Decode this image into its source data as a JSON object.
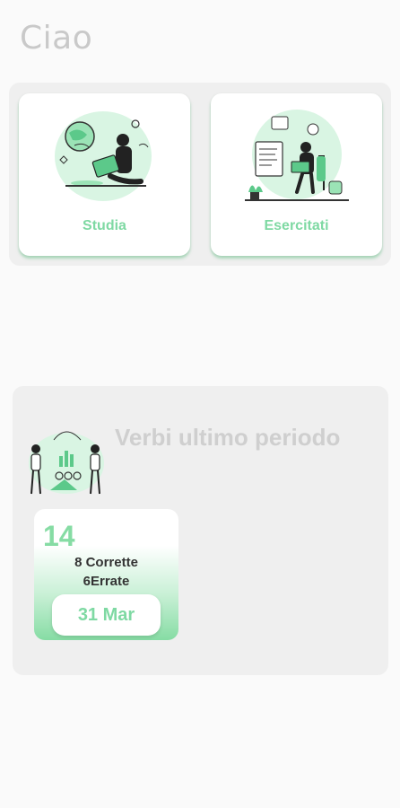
{
  "greeting": "Ciao",
  "actions": {
    "study_label": "Studia",
    "practice_label": "Esercitati"
  },
  "stats": {
    "title": "Verbi ultimo periodo",
    "days": [
      {
        "count": "14",
        "correct": "8 Corrette",
        "wrong": "6Errate",
        "date": "31 Mar"
      }
    ]
  },
  "icons": {
    "study": "person-reading-globe-illustration",
    "practice": "person-laptop-illustration",
    "stats": "people-charts-illustration"
  },
  "colors": {
    "accent": "#7fd9a3",
    "accent_light": "#d9f5e3",
    "background": "#fafafa",
    "panel": "#efefef"
  }
}
